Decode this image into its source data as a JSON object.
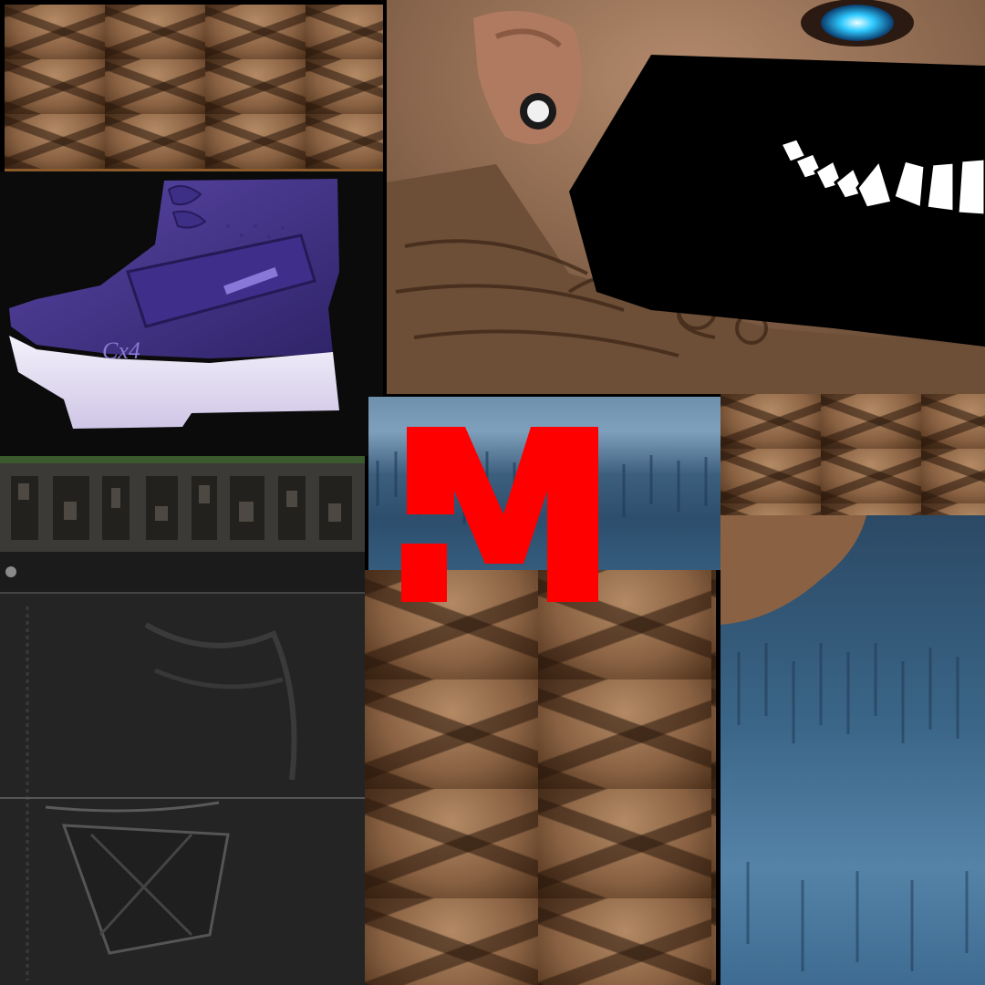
{
  "atlas": {
    "kind": "texture-atlas",
    "tiles": [
      {
        "name": "scales-top",
        "material": "tattooed-skin"
      },
      {
        "name": "shoe",
        "material": "sneaker",
        "color": "#4b3a8c"
      },
      {
        "name": "strip",
        "material": "texture-strip"
      },
      {
        "name": "jeans-black",
        "material": "black-denim"
      },
      {
        "name": "face",
        "material": "skin-with-mask",
        "eye_color": "#2ec9ff"
      },
      {
        "name": "blue-top",
        "material": "blue-paint"
      },
      {
        "name": "scales-center",
        "material": "tattooed-skin"
      },
      {
        "name": "scales-right",
        "material": "tattooed-skin"
      },
      {
        "name": "jeans-blue",
        "material": "blue-denim"
      }
    ]
  },
  "shoe": {
    "logo_text": "Cx4"
  },
  "logo": {
    "text": ".M",
    "color": "#ff0000"
  },
  "colors": {
    "skin": "#8a6243",
    "mask": "#000000",
    "teeth": "#ffffff",
    "accent_red": "#ff0000",
    "denim_blue": "#3b6688",
    "denim_black": "#222222",
    "shoe_purple": "#4b3a8c"
  }
}
